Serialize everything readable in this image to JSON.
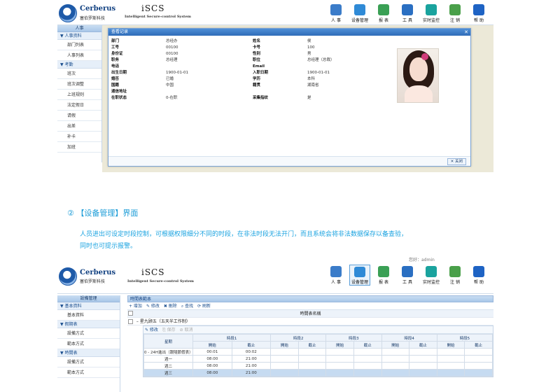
{
  "app": {
    "brand": "Cerberus",
    "brand_sub": "塞伯罗斯科技",
    "product": "iSCS",
    "product_sub": "Intelligent Secure-control System"
  },
  "toolbar": [
    {
      "label": "人 事",
      "icon": "person-icon",
      "color": "#3b7cc9"
    },
    {
      "label": "设备管理",
      "icon": "monitor-icon",
      "color": "#2f8ad6"
    },
    {
      "label": "报 表",
      "icon": "report-icon",
      "color": "#3aa055"
    },
    {
      "label": "工 具",
      "icon": "tools-icon",
      "color": "#2a6fc2"
    },
    {
      "label": "实时监控",
      "icon": "monitor-live-icon",
      "color": "#1aa39e"
    },
    {
      "label": "注 销",
      "icon": "logout-icon",
      "color": "#4aa04a"
    },
    {
      "label": "帮 助",
      "icon": "help-icon",
      "color": "#1e63c4"
    }
  ],
  "screen1": {
    "sidebar": {
      "head": "人事",
      "groups": [
        {
          "label": "▼ 人事资料",
          "items": [
            "部门列表",
            "人事列表"
          ]
        },
        {
          "label": "▼ 考勤",
          "items": [
            "班次",
            "班次调整",
            "上班规则",
            "法定假日",
            "请假",
            "出差",
            "补卡",
            "加班"
          ]
        }
      ]
    },
    "dialog": {
      "title": "查看记录",
      "close_label": "关闭",
      "fields": [
        [
          "部门",
          "总经办",
          "姓名",
          "侯"
        ],
        [
          "工号",
          "00100",
          "卡号",
          "100"
        ],
        [
          "身份证",
          "00100",
          "性别",
          "男"
        ],
        [
          "职务",
          "总经理",
          "职位",
          "总经理（总裁）"
        ],
        [
          "电话",
          "",
          "Email",
          ""
        ],
        [
          "出生日期",
          "1900-01-01",
          "入职日期",
          "1900-01-01"
        ],
        [
          "婚否",
          "已婚",
          "学历",
          "本科"
        ],
        [
          "国籍",
          "中国",
          "籍贯",
          "湖南省"
        ],
        [
          "通信地址",
          "",
          "",
          ""
        ],
        [
          "在职状态",
          "0-在职",
          "采集指纹",
          "是"
        ]
      ]
    }
  },
  "section": {
    "heading": "②  【设备管理】界面",
    "para1": "人员进出可设定时段控制，可根据权限细分不同的时段，在非法时段无法开门，而且系统会将非法数据保存以备查验，",
    "para2": "同时也可提示报警。"
  },
  "screen2": {
    "login_text": "您好：admin",
    "sidebar": {
      "head": "設備管理",
      "groups": [
        {
          "label": "▼ 基本資料",
          "items": [
            "基本資料"
          ]
        },
        {
          "label": "▼ 假期表",
          "items": [
            "設備方式",
            "範本方式"
          ]
        },
        {
          "label": "▼ 時間表",
          "items": [
            "設備方式",
            "範本方式"
          ]
        }
      ]
    },
    "panel_title": "時間表範本",
    "actions": [
      "+ 增加",
      "✎ 修改",
      "✖ 刪除",
      "⌕ 查找",
      "⟳ 刷新"
    ],
    "col_header": "時間表名稱",
    "row_name": "星九顾五（五天半工作制）",
    "sub_actions": [
      "✎ 修改",
      "⎘ 保存",
      "⊘ 取消"
    ],
    "period_headers": [
      "時段1",
      "時段2",
      "時段3",
      "時段4",
      "時段5"
    ],
    "start_label": "開始",
    "end_label": "截止",
    "week_label": "星期",
    "rows": [
      {
        "day": "0 - 24H進出（跟隨節假表）",
        "s": "00:01",
        "e": "00:02"
      },
      {
        "day": "週一",
        "s": "08:00",
        "e": "21:00"
      },
      {
        "day": "週二",
        "s": "08:00",
        "e": "21:00"
      },
      {
        "day": "週三",
        "s": "08:00",
        "e": "21:00"
      }
    ]
  }
}
